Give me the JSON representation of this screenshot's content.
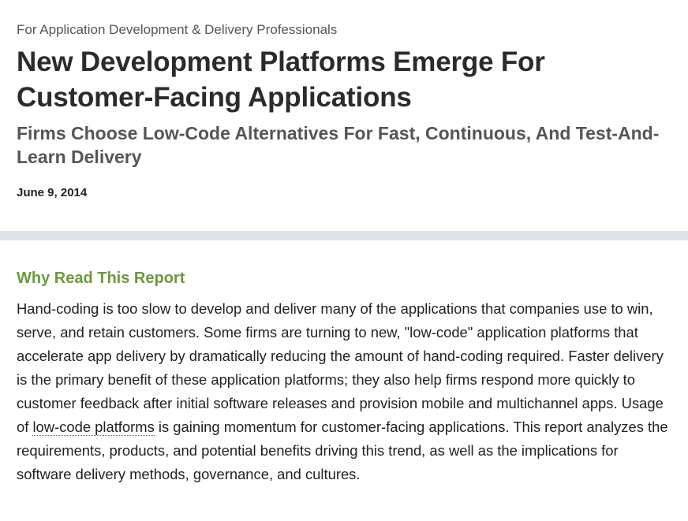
{
  "header": {
    "eyebrow": "For Application Development & Delivery Professionals",
    "title_line1": "New Development Platforms Emerge For",
    "title_line2": "Customer-Facing Applications",
    "subtitle_line1": "Firms Choose Low-Code Alternatives For Fast, Continuous, And Test-And-",
    "subtitle_line2": "Learn Delivery",
    "date": "June 9, 2014"
  },
  "section": {
    "heading": "Why Read This Report",
    "paragraph_before_link": "Hand-coding is too slow to develop and deliver many of the applications that companies use to win, serve, and retain customers. Some firms are turning to new, \"low-code\" application platforms that accelerate app delivery by dramatically reducing the amount of hand-coding required. Faster delivery is the primary benefit of these application platforms; they also help firms respond more quickly to customer feedback after initial software releases and provision mobile and multichannel apps. Usage of ",
    "link_text": "low-code platforms",
    "paragraph_after_link": " is gaining momentum for customer-facing applications. This report analyzes the requirements, products, and potential benefits driving this trend, as well as the implications for software delivery methods, governance, and cultures."
  },
  "colors": {
    "heading_green": "#6b9a3a",
    "divider_gray": "#dde3e7"
  }
}
